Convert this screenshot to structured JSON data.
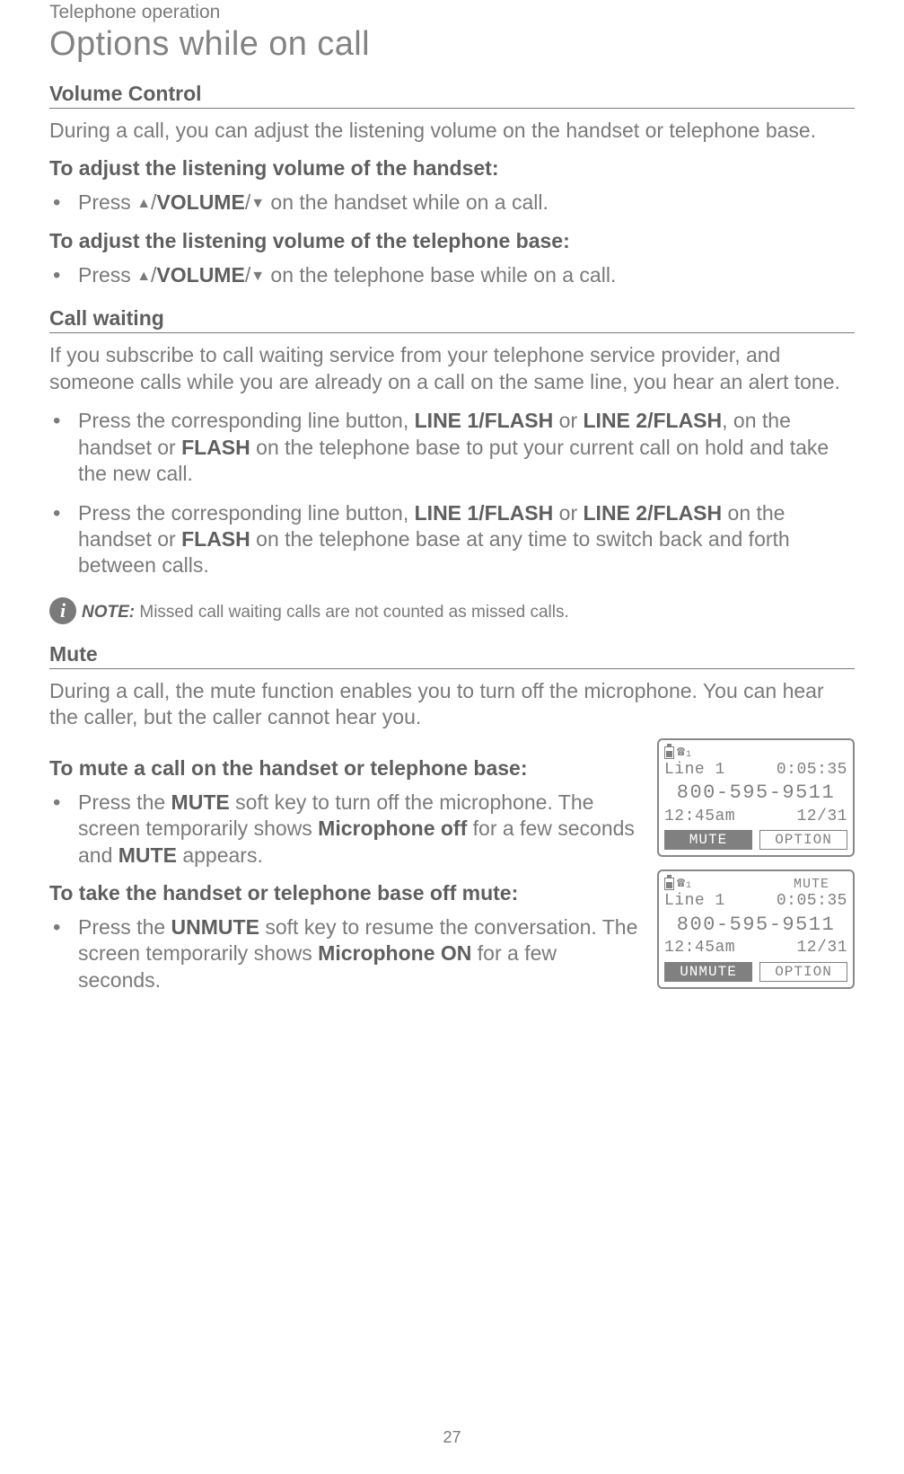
{
  "header": {
    "breadcrumb": "Telephone operation",
    "title": "Options while on call"
  },
  "volume": {
    "heading": "Volume Control",
    "intro": "During a call, you can adjust the listening volume on the handset or telephone base.",
    "handset_label": "To adjust the listening volume of the handset:",
    "handset_bullet_pre": "Press ",
    "volume_word": "VOLUME",
    "handset_bullet_post": " on the handset while on a call.",
    "base_label": "To adjust the listening volume of the telephone base:",
    "base_bullet_post": " on the telephone base while on a call."
  },
  "callwaiting": {
    "heading": "Call waiting",
    "intro": "If you subscribe to call waiting service from your telephone service provider, and someone calls while you are already on a call on the same line, you hear an alert tone.",
    "b1_a": "Press the corresponding line button, ",
    "line1": "LINE 1",
    "flash1": "/FLASH",
    "or": " or ",
    "line2": "LINE 2",
    "flash2": "/FLASH",
    "b1_b": ", on the handset or ",
    "flash_lone": "FLASH",
    "b1_c": " on the telephone base to put your current call on hold and take the new call.",
    "b2_b": " on the handset or ",
    "b2_c": " on the telephone base at any time to switch back and forth between calls.",
    "note_label": "NOTE:",
    "note_text": " Missed call waiting calls are not counted as missed calls."
  },
  "mute": {
    "heading": "Mute",
    "intro": "During a call, the mute function enables you to turn off the microphone. You can hear the caller, but the caller cannot hear you.",
    "on_label": "To mute a call on the handset or telephone base:",
    "b1_a": "Press the ",
    "mute_word": "MUTE",
    "b1_b": " soft key to turn off the microphone. The screen temporarily shows ",
    "mic_off": "Microphone off",
    "b1_c": " for a few seconds and ",
    "mute_word2": "MUTE",
    "b1_d": " appears.",
    "off_label": "To take the handset or telephone base off mute:",
    "b2_a": "Press the ",
    "unmute_word": "UNMUTE",
    "b2_b": " soft key to resume the conversation. The screen temporarily shows ",
    "mic_on": "Microphone ON",
    "b2_c": " for a few seconds."
  },
  "lcd1": {
    "line": "Line 1",
    "timer": "0:05:35",
    "number": "800-595-9511",
    "time": "12:45am",
    "date": "12/31",
    "sk_left": "MUTE",
    "sk_right": "OPTION"
  },
  "lcd2": {
    "mute": "MUTE",
    "line": "Line 1",
    "timer": "0:05:35",
    "number": "800-595-9511",
    "time": "12:45am",
    "date": "12/31",
    "sk_left": "UNMUTE",
    "sk_right": "OPTION"
  },
  "page_number": "27"
}
